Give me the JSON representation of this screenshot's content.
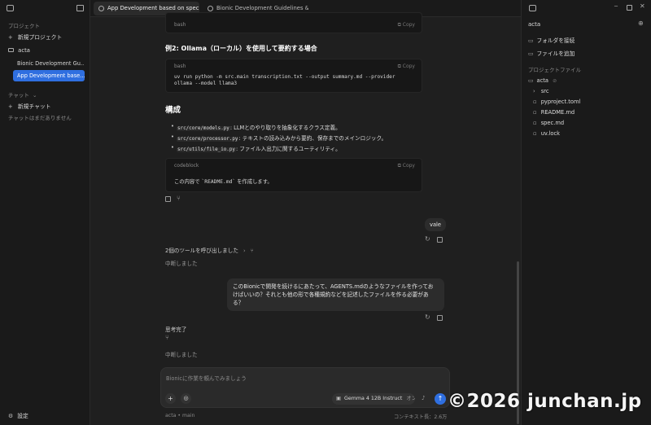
{
  "sidebar": {
    "project_section": "プロジェクト",
    "new_project": "新規プロジェクト",
    "project_name": "acta",
    "projects": [
      {
        "label": "Bionic Development Gu…",
        "active": false
      },
      {
        "label": "App Development base…",
        "active": true
      }
    ],
    "chat_section": "チャット",
    "new_chat": "新規チャット",
    "no_chats": "チャットはまだありません",
    "settings": "設定"
  },
  "tabs": [
    {
      "label": "App Development based on spec…",
      "active": true
    },
    {
      "label": "Bionic Development Guidelines &…",
      "active": false
    }
  ],
  "conversation": {
    "block1": {
      "lang": "bash",
      "copy": "Copy"
    },
    "heading_example2": "例2: Ollama（ローカル）を使用して要約する場合",
    "block2": {
      "lang": "bash",
      "copy": "Copy",
      "line1": "uv run python -m src.main transcription.txt --output summary.md --provider",
      "line2": "ollama --model llama3"
    },
    "heading_structure": "構成",
    "bullets": [
      {
        "code": "src/core/models.py",
        "text": ": LLMとのやり取りを抽象化するクラス定義。"
      },
      {
        "code": "src/core/processor.py",
        "text": ": テキストの読み込みから要約、保存までのメインロジック。"
      },
      {
        "code": "src/utils/file_io.py",
        "text": ": ファイル入出力に関するユーティリティ。"
      }
    ],
    "block3": {
      "lang": "codeblock",
      "copy": "Copy",
      "pre": "この内容で",
      "code": "`README.md`",
      "post": "を作成します。"
    },
    "user_msg1": "vale",
    "tool_calls": "2個のツールを呼び出しました",
    "interrupted1": "中断しました",
    "user_msg2": "このBionicで開発を続けるにあたって、AGENTS.mdのようなファイルを作っておけばいいの？それとも他の形で各種規約などを記述したファイルを作る必要がある？",
    "thinking_done": "思考完了",
    "interrupted2": "中断しました"
  },
  "composer": {
    "placeholder": "Bionicに作業を頼んでみましょう",
    "model": "Gemma 4 12B Instruct",
    "model_toggle": "オン"
  },
  "footer": {
    "breadcrumb": "acta • main",
    "context": "コンテキスト長：2.6万"
  },
  "right_panel": {
    "title": "acta",
    "connect_folder": "フォルダを接続",
    "add_file": "ファイルを追加",
    "files_section": "プロジェクトファイル",
    "root": "acta",
    "root_badge": "⊘",
    "files": [
      "src",
      "pyproject.toml",
      "README.md",
      "spec.md",
      "uv.lock"
    ]
  },
  "watermark": "©2026 junchan.jp",
  "colors": {
    "accent": "#2f6fe0",
    "background": "#1f1f1f",
    "sidebar": "#1a1a1a"
  }
}
